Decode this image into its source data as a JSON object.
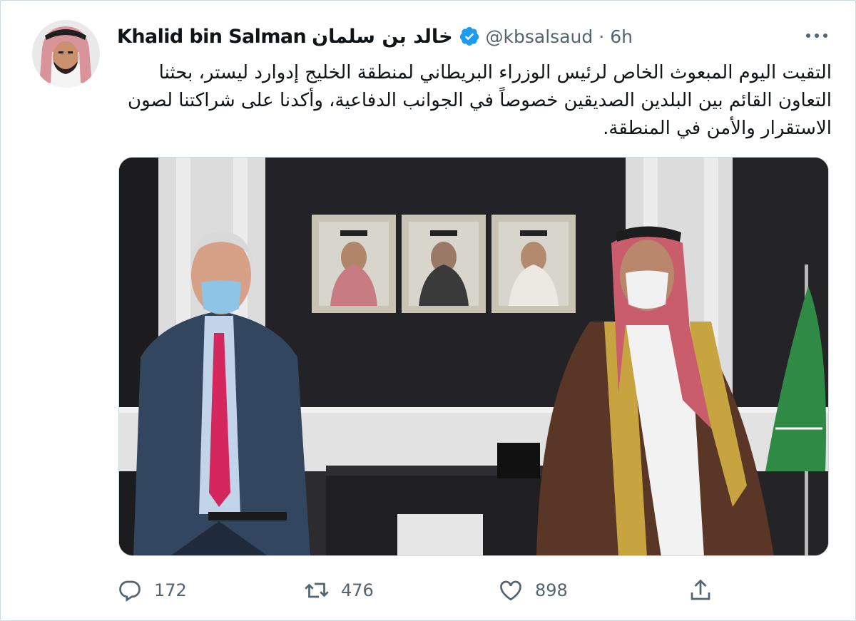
{
  "author": {
    "name_en": "Khalid bin Salman",
    "name_ar": "خالد بن سلمان",
    "handle": "@kbsalsaud",
    "separator": "·",
    "time": "6h",
    "verified": true,
    "avatar_icon": "profile-photo"
  },
  "tweet": {
    "text": "التقيت اليوم المبعوث الخاص لرئيس الوزراء البريطاني لمنطقة الخليج إدوارد ليستر، بحثنا التعاون القائم بين البلدين الصديقين خصوصاً في الجوانب الدفاعية، وأكدنا على شراكتنا لصون الاستقرار والأمن في المنطقة."
  },
  "media": {
    "type": "photo",
    "icon": "meeting-photo"
  },
  "actions": {
    "reply_count": "172",
    "retweet_count": "476",
    "like_count": "898",
    "reply_icon": "reply-icon",
    "retweet_icon": "retweet-icon",
    "like_icon": "heart-icon",
    "share_icon": "share-icon"
  },
  "colors": {
    "accent": "#1d9bf0",
    "text": "#0f1419",
    "secondary": "#536471",
    "border": "#cfd9de"
  }
}
